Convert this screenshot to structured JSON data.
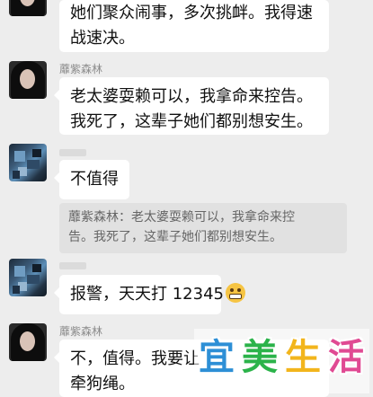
{
  "messages": [
    {
      "type": "text",
      "lines": [
        "她们聚众闹事，多次挑衅。我得速",
        "战速决。"
      ]
    },
    {
      "type": "text",
      "sender": "蘼紫森林",
      "lines": [
        "老太婆耍赖可以，我拿命来控告。",
        "我死了，这辈子她们都别想安生。"
      ]
    },
    {
      "type": "text",
      "lines": [
        "不值得"
      ]
    },
    {
      "type": "quote",
      "lines": [
        "蘼紫森林：老太婆耍赖可以，我拿命来控",
        "告。我死了，这辈子她们都别想安生。"
      ]
    },
    {
      "type": "text",
      "text": "报警，天天打 12345",
      "emoji": "grin-emoji"
    },
    {
      "type": "text",
      "sender": "蘼紫森林",
      "lines": [
        "不，值得。我要让",
        "牵狗绳。"
      ]
    }
  ],
  "watermark": {
    "chars": [
      "宜",
      "美",
      "生",
      "活"
    ],
    "colors": [
      "#2d8fd6",
      "#2bb34a",
      "#f2b51c",
      "#e04a93"
    ]
  }
}
